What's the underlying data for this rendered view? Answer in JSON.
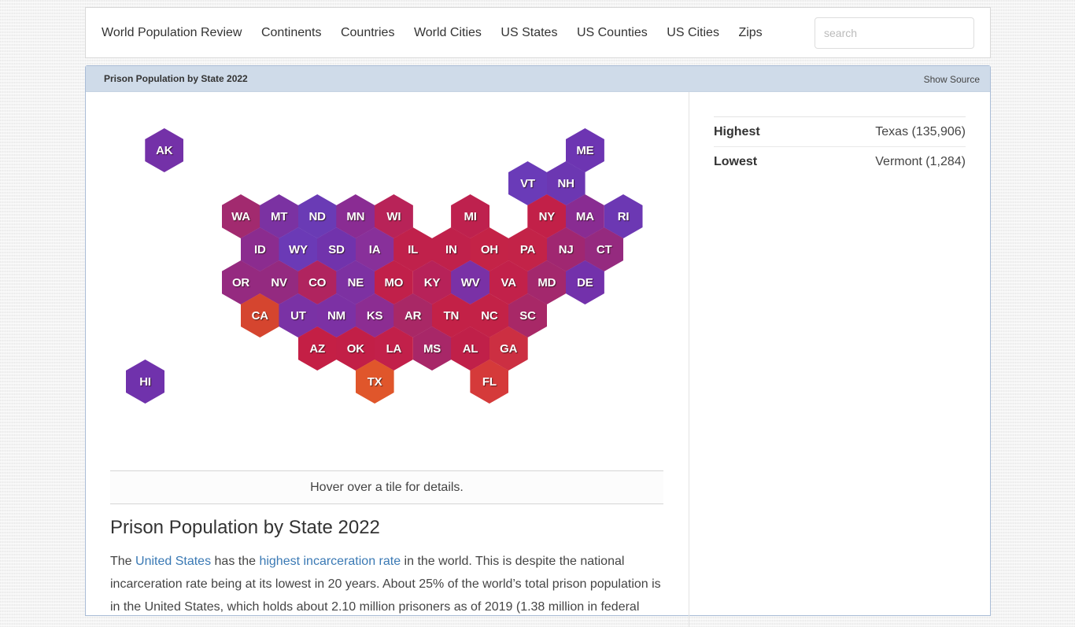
{
  "navbar": {
    "brand": "World Population Review",
    "links": [
      "Continents",
      "Countries",
      "World Cities",
      "US States",
      "US Counties",
      "US Cities",
      "Zips"
    ],
    "search_placeholder": "search"
  },
  "panel": {
    "title": "Prison Population by State 2022",
    "show_source": "Show Source"
  },
  "stats": {
    "highest_label": "Highest",
    "highest_value": "Texas (135,906)",
    "lowest_label": "Lowest",
    "lowest_value": "Vermont (1,284)"
  },
  "hover_hint": "Hover over a tile for details.",
  "article": {
    "title": "Prison Population by State 2022",
    "p1_a": "The ",
    "link1": "United States",
    "p1_b": " has the ",
    "link2": "highest incarceration rate",
    "p1_c": " in the world. This is despite the national incarceration rate being at its lowest in 20 years. About 25% of the world’s total prison population is in the United States, which holds about 2.10 million prisoners as of 2019 (1.38 million in federal"
  },
  "chart_data": {
    "type": "heatmap",
    "title": "Prison Population by State 2022",
    "color_scale": {
      "low": "#6a3bb5",
      "mid": "#c0224a",
      "high": "#e0552b"
    },
    "tiles": [
      {
        "state": "AK",
        "row": 0,
        "col": 0.5,
        "color": "#7431a8"
      },
      {
        "state": "ME",
        "row": 0,
        "col": 11.5,
        "color": "#6d35b2"
      },
      {
        "state": "VT",
        "row": 1,
        "col": 10,
        "color": "#6a3bb8"
      },
      {
        "state": "NH",
        "row": 1,
        "col": 11,
        "color": "#6c37b2"
      },
      {
        "state": "WA",
        "row": 2,
        "col": 2.5,
        "color": "#a22a6f"
      },
      {
        "state": "MT",
        "row": 2,
        "col": 3.5,
        "color": "#7b32a2"
      },
      {
        "state": "ND",
        "row": 2,
        "col": 4.5,
        "color": "#6a3bb5"
      },
      {
        "state": "MN",
        "row": 2,
        "col": 5.5,
        "color": "#8a2c93"
      },
      {
        "state": "WI",
        "row": 2,
        "col": 6.5,
        "color": "#b82358"
      },
      {
        "state": "MI",
        "row": 2,
        "col": 8.5,
        "color": "#be214e"
      },
      {
        "state": "NY",
        "row": 2,
        "col": 10.5,
        "color": "#c22048"
      },
      {
        "state": "MA",
        "row": 2,
        "col": 11.5,
        "color": "#892c92"
      },
      {
        "state": "RI",
        "row": 2,
        "col": 12.5,
        "color": "#6c38b3"
      },
      {
        "state": "ID",
        "row": 3,
        "col": 3,
        "color": "#8b2c8f"
      },
      {
        "state": "WY",
        "row": 3,
        "col": 4,
        "color": "#6b3ab6"
      },
      {
        "state": "SD",
        "row": 3,
        "col": 5,
        "color": "#7133ac"
      },
      {
        "state": "IA",
        "row": 3,
        "col": 6,
        "color": "#88309a"
      },
      {
        "state": "IL",
        "row": 3,
        "col": 7,
        "color": "#c0214b"
      },
      {
        "state": "IN",
        "row": 3,
        "col": 8,
        "color": "#c0214b"
      },
      {
        "state": "OH",
        "row": 3,
        "col": 9,
        "color": "#c42347"
      },
      {
        "state": "PA",
        "row": 3,
        "col": 10,
        "color": "#c32348"
      },
      {
        "state": "NJ",
        "row": 3,
        "col": 11,
        "color": "#a02771"
      },
      {
        "state": "CT",
        "row": 3,
        "col": 12,
        "color": "#952a7f"
      },
      {
        "state": "OR",
        "row": 4,
        "col": 2.5,
        "color": "#952a80"
      },
      {
        "state": "NV",
        "row": 4,
        "col": 3.5,
        "color": "#942a80"
      },
      {
        "state": "CO",
        "row": 4,
        "col": 4.5,
        "color": "#b0245f"
      },
      {
        "state": "NE",
        "row": 4,
        "col": 5.5,
        "color": "#7d31a2"
      },
      {
        "state": "MO",
        "row": 4,
        "col": 6.5,
        "color": "#c1204a"
      },
      {
        "state": "KY",
        "row": 4,
        "col": 7.5,
        "color": "#b72259"
      },
      {
        "state": "WV",
        "row": 4,
        "col": 8.5,
        "color": "#7a31a6"
      },
      {
        "state": "VA",
        "row": 4,
        "col": 9.5,
        "color": "#c2214a"
      },
      {
        "state": "MD",
        "row": 4,
        "col": 10.5,
        "color": "#a3286d"
      },
      {
        "state": "DE",
        "row": 4,
        "col": 11.5,
        "color": "#7331ab"
      },
      {
        "state": "CA",
        "row": 5,
        "col": 3,
        "color": "#d5452f"
      },
      {
        "state": "UT",
        "row": 5,
        "col": 4,
        "color": "#7a32a5"
      },
      {
        "state": "NM",
        "row": 5,
        "col": 5,
        "color": "#7c31a4"
      },
      {
        "state": "KS",
        "row": 5,
        "col": 6,
        "color": "#8c2d92"
      },
      {
        "state": "AR",
        "row": 5,
        "col": 7,
        "color": "#a92866"
      },
      {
        "state": "TN",
        "row": 5,
        "col": 8,
        "color": "#c32147"
      },
      {
        "state": "NC",
        "row": 5,
        "col": 9,
        "color": "#c32247"
      },
      {
        "state": "SC",
        "row": 5,
        "col": 10,
        "color": "#a82867"
      },
      {
        "state": "AZ",
        "row": 6,
        "col": 4.5,
        "color": "#c41f45"
      },
      {
        "state": "OK",
        "row": 6,
        "col": 5.5,
        "color": "#c21f47"
      },
      {
        "state": "LA",
        "row": 6,
        "col": 6.5,
        "color": "#c2204a"
      },
      {
        "state": "MS",
        "row": 6,
        "col": 7.5,
        "color": "#a82768"
      },
      {
        "state": "AL",
        "row": 6,
        "col": 8.5,
        "color": "#c02049"
      },
      {
        "state": "GA",
        "row": 6,
        "col": 9.5,
        "color": "#cc2f42"
      },
      {
        "state": "HI",
        "row": 7,
        "col": 0,
        "color": "#7032ac"
      },
      {
        "state": "TX",
        "row": 7,
        "col": 6,
        "color": "#e0562b"
      },
      {
        "state": "FL",
        "row": 7,
        "col": 9,
        "color": "#d53a3a"
      }
    ]
  }
}
